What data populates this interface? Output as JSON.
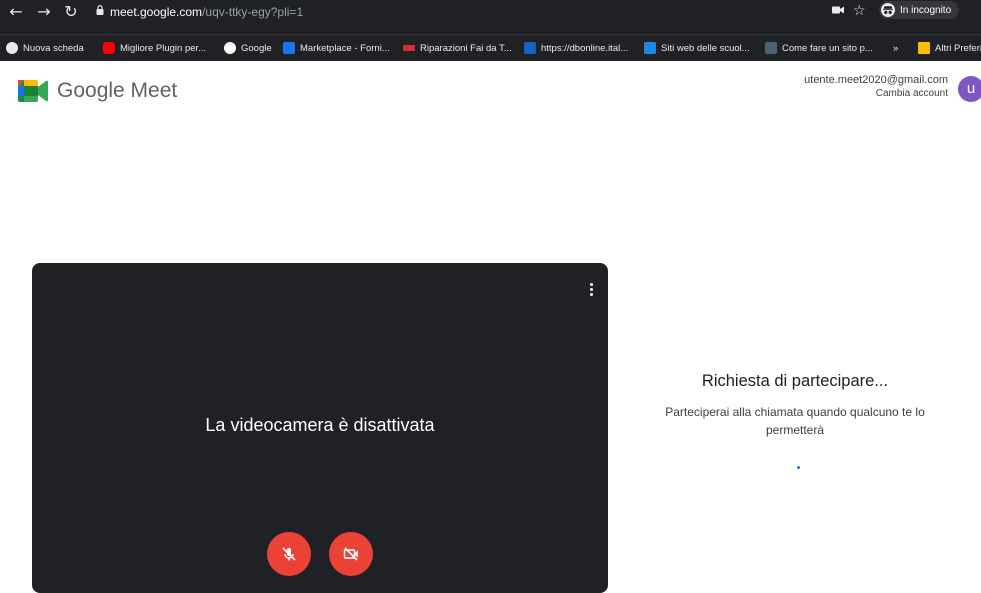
{
  "browser": {
    "url_host": "meet.google.com",
    "url_path": "/uqv-ttky-egy?pli=1",
    "incognito_label": "In incognito",
    "bookmarks": [
      {
        "label": "Nuova scheda",
        "icon": "globe-icon"
      },
      {
        "label": "Migliore Plugin per...",
        "icon": "youtube-icon"
      },
      {
        "label": "Google",
        "icon": "google-icon"
      },
      {
        "label": "Marketplace - Forni...",
        "icon": "facebook-icon"
      },
      {
        "label": "Riparazioni Fai da T...",
        "icon": "sos-icon"
      },
      {
        "label": "https://dbonline.ital...",
        "icon": "z-icon"
      },
      {
        "label": "Siti web delle scuol...",
        "icon": "it-icon"
      },
      {
        "label": "Come fare un sito p...",
        "icon": "site-icon"
      }
    ],
    "more_bookmarks": "»",
    "other_bookmarks": "Altri Preferiti"
  },
  "meet": {
    "title": "Google Meet",
    "account_email": "utente.meet2020@gmail.com",
    "switch_account": "Cambia account",
    "avatar_letter": "u"
  },
  "preview": {
    "camera_off_message": "La videocamera è disattivata",
    "mic_state": "off",
    "camera_state": "off"
  },
  "join": {
    "title": "Richiesta di partecipare...",
    "message": "Parteciperai alla chiamata quando qualcuno te lo permetterà"
  },
  "colors": {
    "chrome_bg": "#202124",
    "video_bg": "#202124",
    "control_red": "#ea4335",
    "avatar": "#7e57c2"
  }
}
